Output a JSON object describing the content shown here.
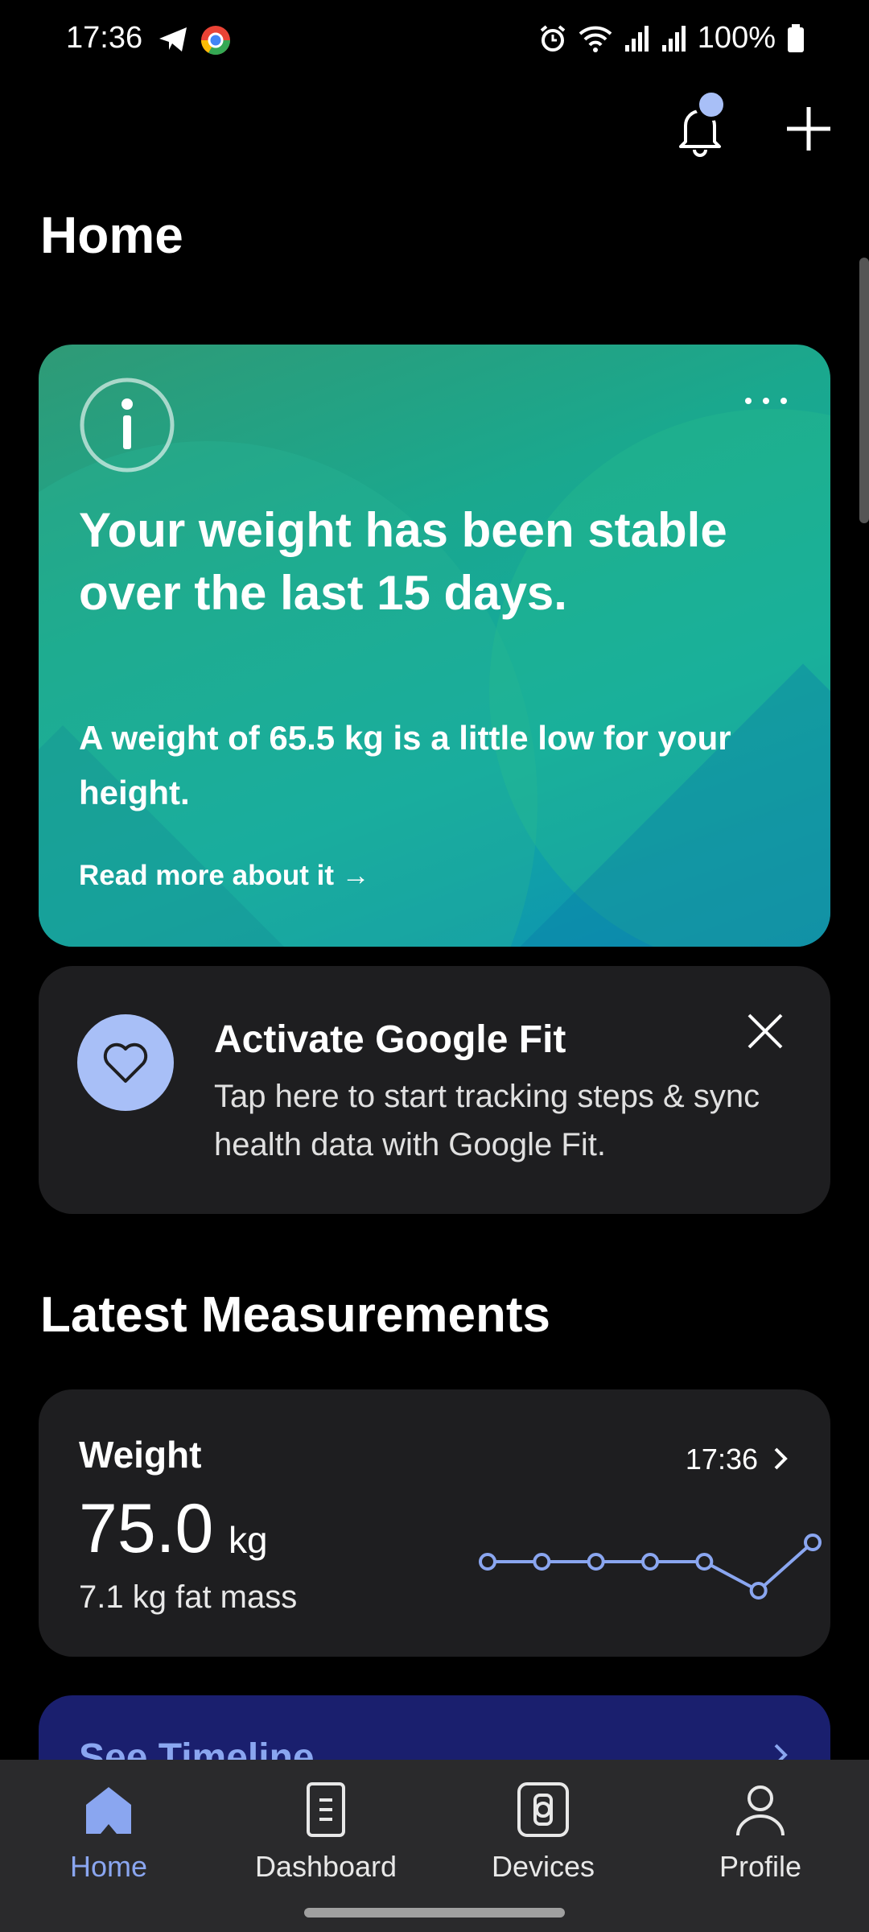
{
  "status_bar": {
    "time": "17:36",
    "battery": "100%",
    "left_icons": [
      "telegram-icon",
      "chrome-icon"
    ],
    "right_icons": [
      "alarm-icon",
      "wifi-icon",
      "signal-icon",
      "signal-icon",
      "battery-icon"
    ]
  },
  "header": {
    "title": "Home",
    "actions": [
      "bell-icon",
      "plus-icon"
    ]
  },
  "insight_card": {
    "title": "Your weight has been stable over the last 15 days.",
    "body": "A weight of 65.5 kg is a little low for your height.",
    "link": "Read more about it →"
  },
  "fit_card": {
    "title": "Activate Google Fit",
    "description": "Tap here to start tracking steps & sync health data with Google Fit."
  },
  "latest": {
    "section_title": "Latest Measurements",
    "weight": {
      "label": "Weight",
      "time": "17:36",
      "value": "75.0",
      "unit": "kg",
      "fat_mass": "7.1 kg fat mass",
      "trend": [
        75.0,
        75.0,
        75.0,
        75.0,
        75.0,
        73.5,
        76.0
      ]
    }
  },
  "timeline": {
    "label": "See Timeline"
  },
  "bottom_nav": {
    "items": [
      {
        "label": "Home",
        "icon": "home-icon",
        "active": true
      },
      {
        "label": "Dashboard",
        "icon": "dashboard-icon",
        "active": false
      },
      {
        "label": "Devices",
        "icon": "watch-icon",
        "active": false
      },
      {
        "label": "Profile",
        "icon": "person-icon",
        "active": false
      }
    ]
  },
  "colors": {
    "accent": "#8aa6f0",
    "card_bg": "#1e1e20",
    "badge": "#a8bff7",
    "timeline_bg": "#1a1f6e"
  }
}
